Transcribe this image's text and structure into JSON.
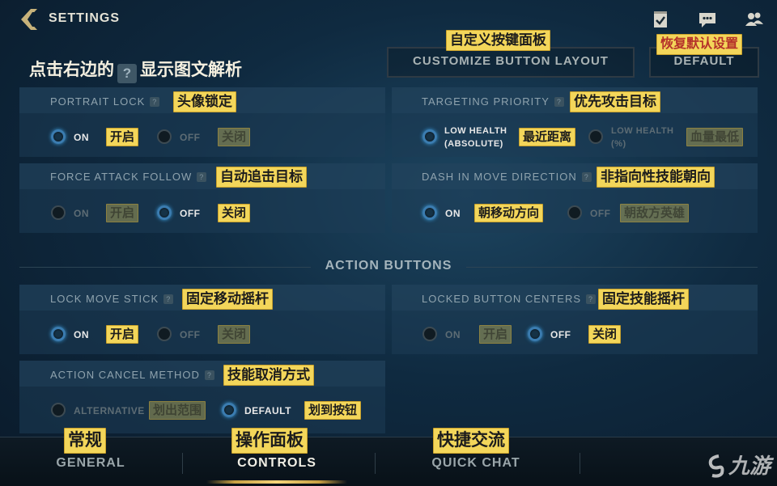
{
  "header": {
    "back_icon": "back-chevron-icon",
    "title": "SETTINGS",
    "icons": [
      "checklist-icon",
      "chat-icon",
      "friends-icon"
    ]
  },
  "hint": {
    "before": "点击右边的",
    "q": "?",
    "after": "显示图文解析"
  },
  "top_buttons": {
    "customize": "CUSTOMIZE BUTTON LAYOUT",
    "customize_tag": "自定义按键面板",
    "default": "DEFAULT",
    "default_tag": "恢复默认设置"
  },
  "settings": {
    "portrait_lock": {
      "label": "PORTRAIT LOCK",
      "tag": "头像锁定",
      "q": "?",
      "opt1": "ON",
      "opt1_tag": "开启",
      "opt2": "OFF",
      "opt2_tag": "关闭",
      "selected": "ON"
    },
    "targeting_priority": {
      "label": "TARGETING PRIORITY",
      "tag": "优先攻击目标",
      "q": "?",
      "opt1": "LOW HEALTH\n(ABSOLUTE)",
      "opt1_tag": "最近距离",
      "opt2": "LOW HEALTH\n(%)",
      "opt2_tag": "血量最低",
      "selected": "LOW HEALTH (ABSOLUTE)"
    },
    "force_attack_follow": {
      "label": "FORCE ATTACK FOLLOW",
      "tag": "自动追击目标",
      "q": "?",
      "opt1": "ON",
      "opt1_tag": "开启",
      "opt2": "OFF",
      "opt2_tag": "关闭",
      "selected": "OFF"
    },
    "dash_in_move_direction": {
      "label": "DASH IN MOVE DIRECTION",
      "tag": "非指向性技能朝向",
      "q": "?",
      "opt1": "ON",
      "opt1_tag": "朝移动方向",
      "opt2": "OFF",
      "opt2_tag": "朝敌方英雄",
      "selected": "ON"
    },
    "action_buttons_title": "ACTION BUTTONS",
    "lock_move_stick": {
      "label": "LOCK MOVE STICK",
      "tag": "固定移动摇杆",
      "q": "?",
      "opt1": "ON",
      "opt1_tag": "开启",
      "opt2": "OFF",
      "opt2_tag": "关闭",
      "selected": "ON"
    },
    "locked_button_centers": {
      "label": "LOCKED BUTTON CENTERS",
      "tag": "固定技能摇杆",
      "q": "?",
      "opt1": "ON",
      "opt1_tag": "开启",
      "opt2": "OFF",
      "opt2_tag": "关闭",
      "selected": "OFF"
    },
    "action_cancel_method": {
      "label": "ACTION CANCEL METHOD",
      "tag": "技能取消方式",
      "q": "?",
      "opt1": "ALTERNATIVE",
      "opt1_tag": "划出范围",
      "opt2": "DEFAULT",
      "opt2_tag": "划到按钮",
      "selected": "DEFAULT"
    }
  },
  "tabs": [
    {
      "label": "GENERAL",
      "tag": "常规"
    },
    {
      "label": "CONTROLS",
      "tag": "操作面板",
      "active": true
    },
    {
      "label": "QUICK CHAT",
      "tag": "快捷交流"
    }
  ],
  "watermark": "九游"
}
